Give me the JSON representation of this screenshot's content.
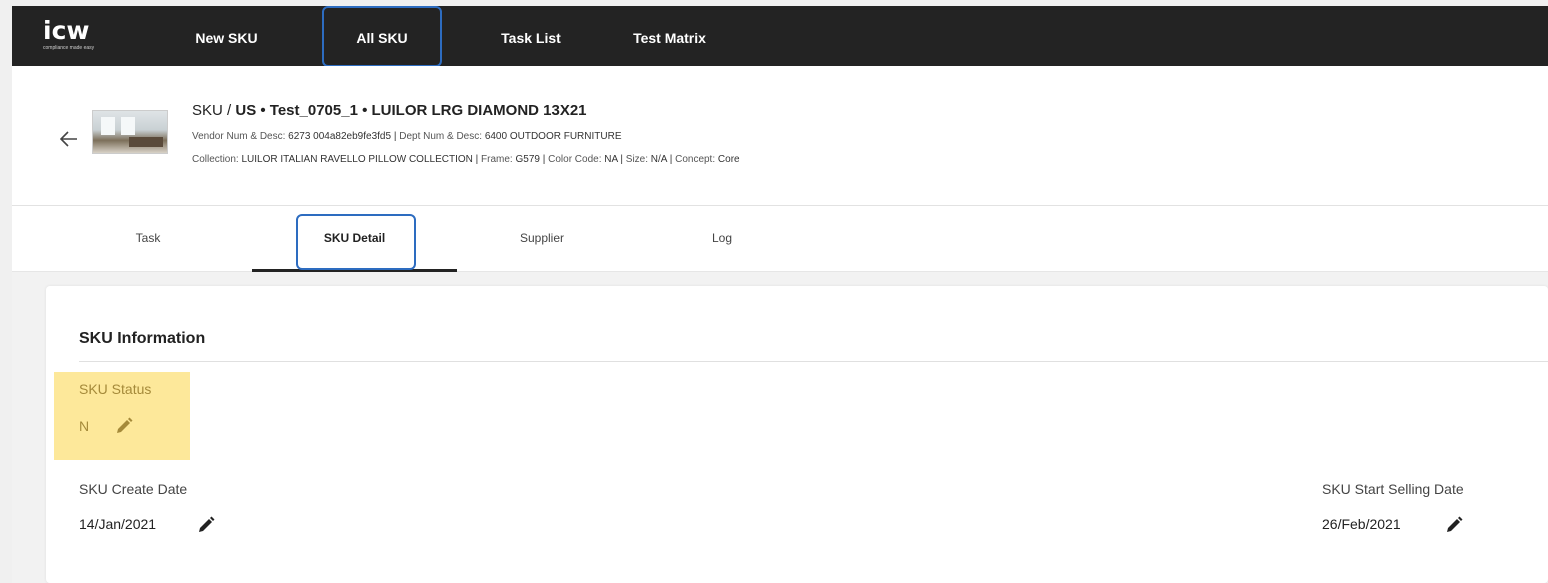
{
  "nav": {
    "logo_text": "icw",
    "logo_tagline": "compliance made easy",
    "items": [
      {
        "label": "New SKU"
      },
      {
        "label": "All SKU"
      },
      {
        "label": "Task List"
      },
      {
        "label": "Test Matrix"
      }
    ]
  },
  "header": {
    "crumb_prefix": "SKU /",
    "crumb_title": "US • Test_0705_1 • LUILOR LRG DIAMOND 13X21",
    "vendor_label": "Vendor Num & Desc:",
    "vendor_value": "6273 004a82eb9fe3fd5",
    "dept_label": "Dept Num & Desc:",
    "dept_value": "6400 OUTDOOR FURNITURE",
    "collection_label": "Collection:",
    "collection_value": "LUILOR ITALIAN RAVELLO PILLOW COLLECTION",
    "frame_label": "Frame:",
    "frame_value": "G579",
    "color_label": "Color Code:",
    "color_value": "NA",
    "size_label": "Size:",
    "size_value": "N/A",
    "concept_label": "Concept:",
    "concept_value": "Core",
    "separator": "|"
  },
  "tabs": [
    {
      "label": "Task"
    },
    {
      "label": "SKU Detail"
    },
    {
      "label": "Supplier"
    },
    {
      "label": "Log"
    }
  ],
  "card": {
    "title": "SKU Information",
    "sku_status_label": "SKU Status",
    "sku_status_value": "N",
    "create_date_label": "SKU Create Date",
    "create_date_value": "14/Jan/2021",
    "start_selling_label": "SKU Start Selling Date",
    "start_selling_value": "26/Feb/2021"
  },
  "colors": {
    "nav_bg": "#232323",
    "highlight_box": "#2d6cc0",
    "status_highlight": "#fde89a"
  }
}
